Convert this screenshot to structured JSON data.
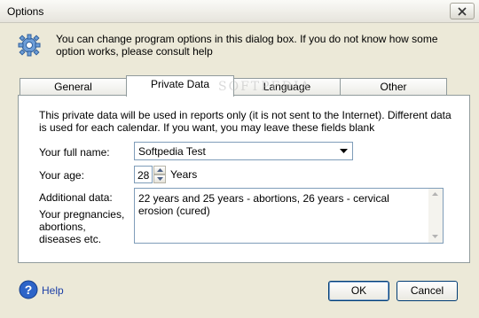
{
  "window": {
    "title": "Options"
  },
  "header": {
    "text": "You can change program options in this dialog box. If you do not know how some option works, please consult help"
  },
  "tabs": [
    {
      "label": "General",
      "active": false
    },
    {
      "label": "Private Data",
      "active": true
    },
    {
      "label": "Language",
      "active": false
    },
    {
      "label": "Other",
      "active": false
    }
  ],
  "panel": {
    "intro": "This private data will be used in reports only (it is not sent to the Internet). Different data is used for each calendar. If you want, you may leave these fields blank",
    "full_name": {
      "label": "Your full name:",
      "value": "Softpedia Test"
    },
    "age": {
      "label": "Your age:",
      "value": "28",
      "unit": "Years"
    },
    "additional": {
      "label": "Additional data:",
      "hint": "Your pregnancies, abortions, diseases etc.",
      "value": "22 years and 25 years - abortions, 26 years - cervical erosion (cured)"
    }
  },
  "footer": {
    "help_label": "Help",
    "ok_label": "OK",
    "cancel_label": "Cancel"
  },
  "watermark": "SOFTPEDIA",
  "colors": {
    "accent": "#316ac5",
    "tab_border": "#919b9c",
    "background": "#ece9d8"
  }
}
